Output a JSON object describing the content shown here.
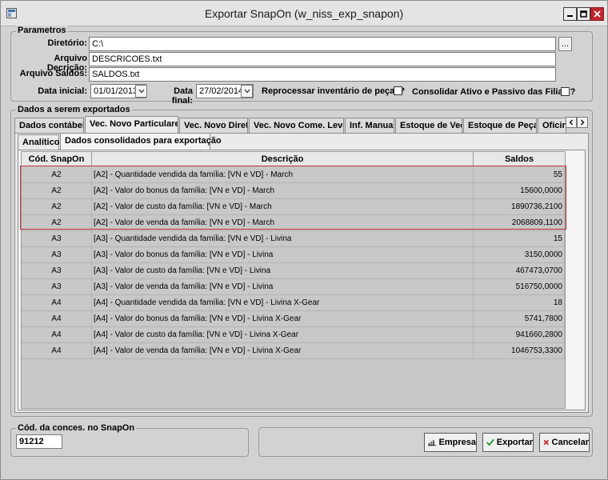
{
  "window": {
    "title": "Exportar SnapOn (w_niss_exp_snapon)",
    "controls": [
      "minimize-icon",
      "maximize-icon",
      "close-icon"
    ]
  },
  "parametros": {
    "title": "Parametros",
    "diretorio_label": "Diretório:",
    "diretorio_value": "C:\\",
    "browse_label": "...",
    "arquivo_descricao_label": "Arquivo Decrição:",
    "arquivo_descricao_value": "DESCRICOES.txt",
    "arquivo_saldos_label": "Arquivo Saldos:",
    "arquivo_saldos_value": "SALDOS.txt",
    "data_inicial_label": "Data inicial:",
    "data_inicial_value": "01/01/2013",
    "data_final_label": "Data final:",
    "data_final_value": "27/02/2014",
    "reprocessar_label": "Reprocessar inventário de peças?",
    "consolidar_label": "Consolidar Ativo e Passivo das Filiais?"
  },
  "dados": {
    "title": "Dados a serem exportados",
    "tabs": [
      {
        "label": "Dados contábeis"
      },
      {
        "label": "Vec. Novo Particulares"
      },
      {
        "label": "Vec. Novo Direta"
      },
      {
        "label": "Vec. Novo Come. Leves"
      },
      {
        "label": "Inf. Manual"
      },
      {
        "label": "Estoque de Vec."
      },
      {
        "label": "Estoque de Peças"
      },
      {
        "label": "Oficina"
      }
    ],
    "subtabs": [
      {
        "label": "Analítico"
      },
      {
        "label": "Dados consolidados para exportação"
      }
    ],
    "columns": [
      "Cód. SnapOn",
      "Descrição",
      "Saldos"
    ],
    "rows": [
      {
        "cod": "A2",
        "desc": "[A2] - Quantidade vendida da família: [VN e VD] - March",
        "saldo": "55"
      },
      {
        "cod": "A2",
        "desc": "[A2] - Valor do bonus da família: [VN e VD] - March",
        "saldo": "15600,0000"
      },
      {
        "cod": "A2",
        "desc": "[A2] - Valor de custo da família: [VN e VD] - March",
        "saldo": "1890736,2100"
      },
      {
        "cod": "A2",
        "desc": "[A2] - Valor de venda da família: [VN e VD] - March",
        "saldo": "2068809,1100"
      },
      {
        "cod": "A3",
        "desc": "[A3] - Quantidade vendida da família: [VN e VD] - Livina",
        "saldo": "15"
      },
      {
        "cod": "A3",
        "desc": "[A3] - Valor do bonus da família: [VN e VD] - Livina",
        "saldo": "3150,0000"
      },
      {
        "cod": "A3",
        "desc": "[A3] - Valor de custo da família: [VN e VD] - Livina",
        "saldo": "467473,0700"
      },
      {
        "cod": "A3",
        "desc": "[A3] - Valor de venda da família: [VN e VD] - Livina",
        "saldo": "516750,0000"
      },
      {
        "cod": "A4",
        "desc": "[A4] - Quantidade vendida da família: [VN e VD] - Livina X-Gear",
        "saldo": "18"
      },
      {
        "cod": "A4",
        "desc": "[A4] - Valor do bonus da família: [VN e VD] - Livina X-Gear",
        "saldo": "5741,7800"
      },
      {
        "cod": "A4",
        "desc": "[A4] - Valor de custo da família: [VN e VD] - Livina X-Gear",
        "saldo": "941660,2800"
      },
      {
        "cod": "A4",
        "desc": "[A4] - Valor de venda da família: [VN e VD] - Livina X-Gear",
        "saldo": "1046753,3300"
      }
    ]
  },
  "concessionaria": {
    "title": "Cód. da conces. no SnapOn",
    "value": "91212"
  },
  "buttons": {
    "empresa": "Empresa",
    "exportar": "Exportar",
    "cancelar": "Cancelar"
  },
  "colors": {
    "highlight_border": "#c0323b",
    "close_button": "#c1272d",
    "exportar_check": "#1a9a2a",
    "cancelar_x": "#cc1a1a"
  }
}
